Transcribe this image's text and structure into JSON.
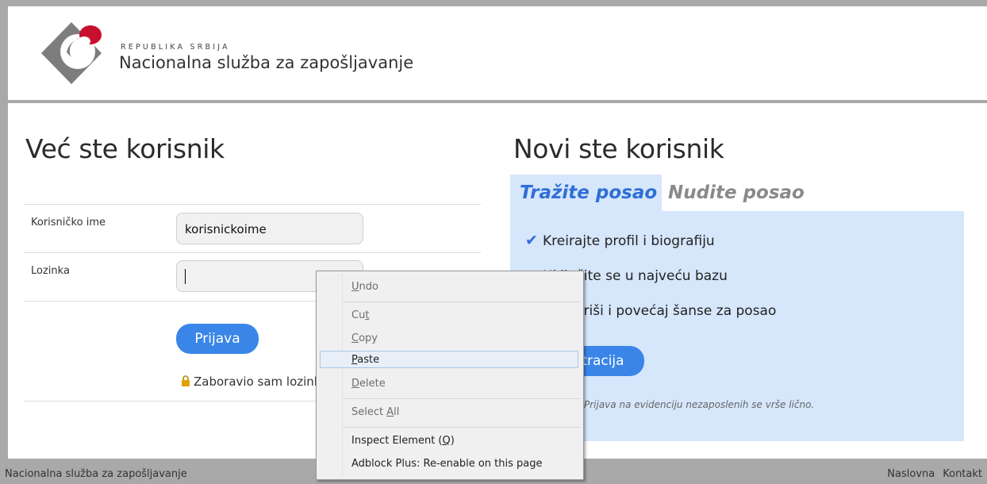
{
  "header": {
    "org_sup": "REPUBLIKA SRBIJA",
    "org_name": "Nacionalna služba za zapošljavanje"
  },
  "login": {
    "title": "Već ste korisnik",
    "username_label": "Korisničko ime",
    "username_value": "korisnickoime",
    "password_label": "Lozinka",
    "submit_label": "Prijava",
    "forgot_label": "Zaboravio sam lozinku"
  },
  "register": {
    "title": "Novi ste korisnik",
    "tabs": [
      {
        "label": "Tražite posao",
        "active": true
      },
      {
        "label": "Nudite posao",
        "active": false
      }
    ],
    "features": [
      "Kreirajte profil i biografiju",
      "Uključite se u najveću bazu",
      "Konkuriši i povećaj šanse za posao"
    ],
    "register_button": "Registracija",
    "note": "Prijava na evidenciju nezaposlenih se vrše lično."
  },
  "footer": {
    "left": "Nacionalna služba za zapošljavanje",
    "links": [
      "Naslovna",
      "Kontakt"
    ]
  },
  "context_menu": {
    "undo_pre": "",
    "undo_key": "U",
    "undo_post": "ndo",
    "cut_pre": "Cu",
    "cut_key": "t",
    "cut_post": "",
    "copy_pre": "",
    "copy_key": "C",
    "copy_post": "opy",
    "paste_pre": "",
    "paste_key": "P",
    "paste_post": "aste",
    "delete_pre": "",
    "delete_key": "D",
    "delete_post": "elete",
    "selectall_pre": "Select ",
    "selectall_key": "A",
    "selectall_post": "ll",
    "inspect_pre": "Inspect Element (",
    "inspect_key": "Q",
    "inspect_post": ")",
    "adblock": "Adblock Plus: Re-enable on this page",
    "highlighted": "Paste"
  },
  "colors": {
    "accent": "#3a86e8",
    "tab_active": "#2f6fd6",
    "tab_inactive": "#8a8a8a",
    "panel_bg": "#d6e6fb",
    "logo_red": "#c8102e",
    "logo_gray": "#7d7d7d"
  }
}
